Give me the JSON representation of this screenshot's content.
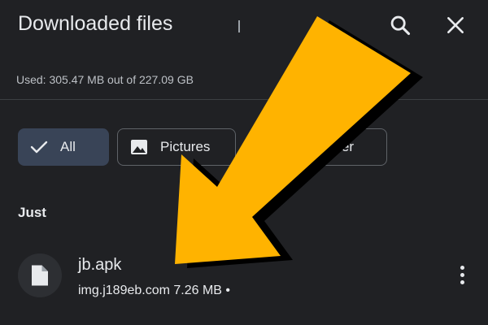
{
  "header": {
    "title": "Downloaded files",
    "search_icon": "search-icon",
    "close_icon": "close-icon"
  },
  "storage": {
    "text": "Used: 305.47 MB out of 227.09 GB"
  },
  "filters": {
    "all_label": "All",
    "pictures_label": "Pictures",
    "other_label": "er"
  },
  "section": {
    "label": "Just"
  },
  "files": [
    {
      "name": "jb.apk",
      "meta": "img.j189eb.com 7.26 MB •",
      "icon": "file-icon"
    }
  ],
  "colors": {
    "background": "#202124",
    "chip_selected": "#394457",
    "arrow": "#FFB300"
  }
}
